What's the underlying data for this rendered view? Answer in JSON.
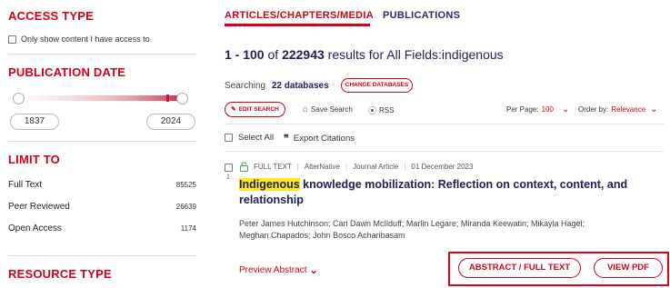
{
  "sidebar": {
    "access_type": {
      "heading": "ACCESS TYPE",
      "checkbox_label": "Only show content I have access to"
    },
    "publication_date": {
      "heading": "PUBLICATION DATE",
      "from_year": "1837",
      "to_year": "2024"
    },
    "limit_to": {
      "heading": "LIMIT TO",
      "items": [
        {
          "label": "Full Text",
          "count": "85525"
        },
        {
          "label": "Peer Reviewed",
          "count": "26639"
        },
        {
          "label": "Open Access",
          "count": "1174"
        }
      ]
    },
    "resource_type": {
      "heading": "RESOURCE TYPE"
    }
  },
  "tabs": [
    {
      "label": "ARTICLES/CHAPTERS/MEDIA",
      "active": true
    },
    {
      "label": "PUBLICATIONS",
      "active": false
    }
  ],
  "results": {
    "range": "1 - 100",
    "of": "of",
    "total": "222943",
    "query_text": "results for All Fields:indigenous"
  },
  "databases": {
    "searching_label": "Searching",
    "count_text": "22 databases",
    "change_button": "CHANGE DATABASES"
  },
  "toolbar": {
    "edit_search": "EDIT SEARCH",
    "save_search": "Save Search",
    "rss": "RSS",
    "per_page_label": "Per Page:",
    "per_page_value": "100",
    "order_by_label": "Order by:",
    "order_by_value": "Relevance"
  },
  "select_bar": {
    "select_all": "Select All",
    "export": "Export Citations"
  },
  "result_item": {
    "number": "1",
    "full_text": "FULL TEXT",
    "source": "AlterNative",
    "type": "Journal Article",
    "date": "01 December 2023",
    "title_highlight": "Indigenous",
    "title_rest_line1": " knowledge mobilization: Reflection on context, content, and",
    "title_line2": "relationship",
    "authors_line1": "Peter James Hutchinson; Cari Dawn McIlduff; Marlin Legare; Miranda Keewatin; Mikayla Hagel;",
    "authors_line2": "Meghan Chapados; John Bosco Acharibasam",
    "preview": "Preview Abstract",
    "abstract_button": "ABSTRACT / FULL TEXT",
    "pdf_button": "VIEW PDF"
  },
  "colors": {
    "accent": "#d0021b",
    "title": "#1f1f5a",
    "highlight": "#ffe81a"
  }
}
